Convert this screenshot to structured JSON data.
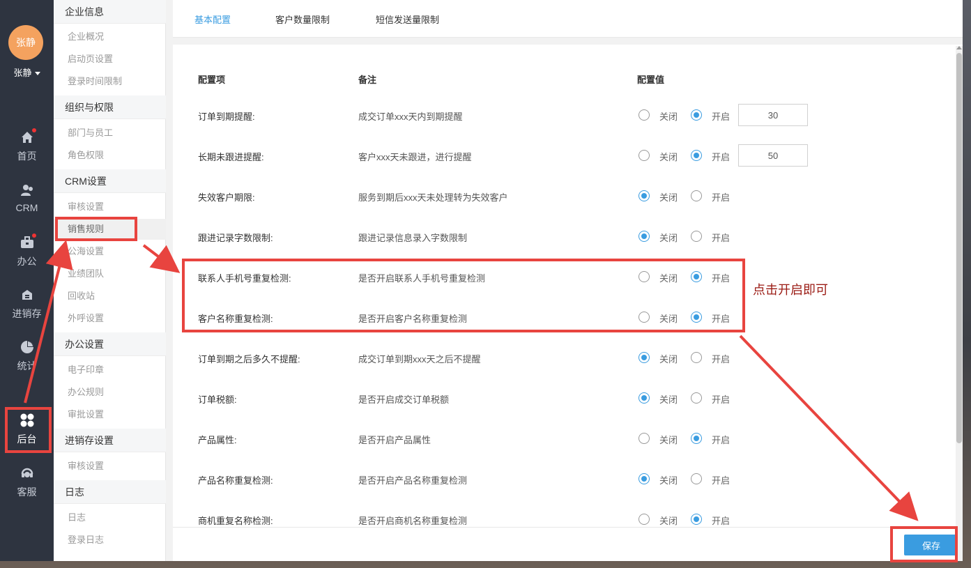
{
  "user": {
    "avatar_text": "张静",
    "name": "张静"
  },
  "nav": {
    "items": [
      {
        "label": "首页",
        "icon": "home-icon"
      },
      {
        "label": "CRM",
        "icon": "customers-icon"
      },
      {
        "label": "办公",
        "icon": "briefcase-icon"
      },
      {
        "label": "进销存",
        "icon": "warehouse-icon"
      },
      {
        "label": "统计",
        "icon": "pie-chart-icon"
      },
      {
        "label": "后台",
        "icon": "grid-icon"
      },
      {
        "label": "客服",
        "icon": "headset-icon"
      }
    ]
  },
  "submenu": {
    "groups": [
      {
        "title": "企业信息",
        "items": [
          "企业概况",
          "启动页设置",
          "登录时间限制"
        ]
      },
      {
        "title": "组织与权限",
        "items": [
          "部门与员工",
          "角色权限"
        ]
      },
      {
        "title": "CRM设置",
        "items": [
          "审核设置",
          "销售规则",
          "公海设置",
          "业绩团队",
          "回收站",
          "外呼设置"
        ]
      },
      {
        "title": "办公设置",
        "items": [
          "电子印章",
          "办公规则",
          "审批设置"
        ]
      },
      {
        "title": "进销存设置",
        "items": [
          "审核设置"
        ]
      },
      {
        "title": "日志",
        "items": [
          "日志",
          "登录日志"
        ]
      }
    ],
    "current": "销售规则"
  },
  "tabs": [
    "基本配置",
    "客户数量限制",
    "短信发送量限制"
  ],
  "table": {
    "headers": {
      "name": "配置项",
      "note": "备注",
      "value": "配置值"
    },
    "off_label": "关闭",
    "on_label": "开启",
    "rows": [
      {
        "name": "订单到期提醒:",
        "note": "成交订单xxx天内到期提醒",
        "enabled": true,
        "input": "30"
      },
      {
        "name": "长期未跟进提醒:",
        "note": "客户xxx天未跟进，进行提醒",
        "enabled": true,
        "input": "50"
      },
      {
        "name": "失效客户期限:",
        "note": "服务到期后xxx天未处理转为失效客户",
        "enabled": false
      },
      {
        "name": "跟进记录字数限制:",
        "note": "跟进记录信息录入字数限制",
        "enabled": false
      },
      {
        "name": "联系人手机号重复检测:",
        "note": "是否开启联系人手机号重复检测",
        "enabled": true
      },
      {
        "name": "客户名称重复检测:",
        "note": "是否开启客户名称重复检测",
        "enabled": true
      },
      {
        "name": "订单到期之后多久不提醒:",
        "note": "成交订单到期xxx天之后不提醒",
        "enabled": false
      },
      {
        "name": "订单税额:",
        "note": "是否开启成交订单税额",
        "enabled": false
      },
      {
        "name": "产品属性:",
        "note": "是否开启产品属性",
        "enabled": true
      },
      {
        "name": "产品名称重复检测:",
        "note": "是否开启产品名称重复检测",
        "enabled": false
      },
      {
        "name": "商机重复名称检测:",
        "note": "是否开启商机名称重复检测",
        "enabled": true
      }
    ]
  },
  "footer": {
    "save_label": "保存"
  },
  "annotation": {
    "text": "点击开启即可",
    "color": "#e8443f"
  },
  "colors": {
    "accent": "#3a9ce0",
    "nav_bg": "#2e3440",
    "avatar": "#f4a25f"
  }
}
